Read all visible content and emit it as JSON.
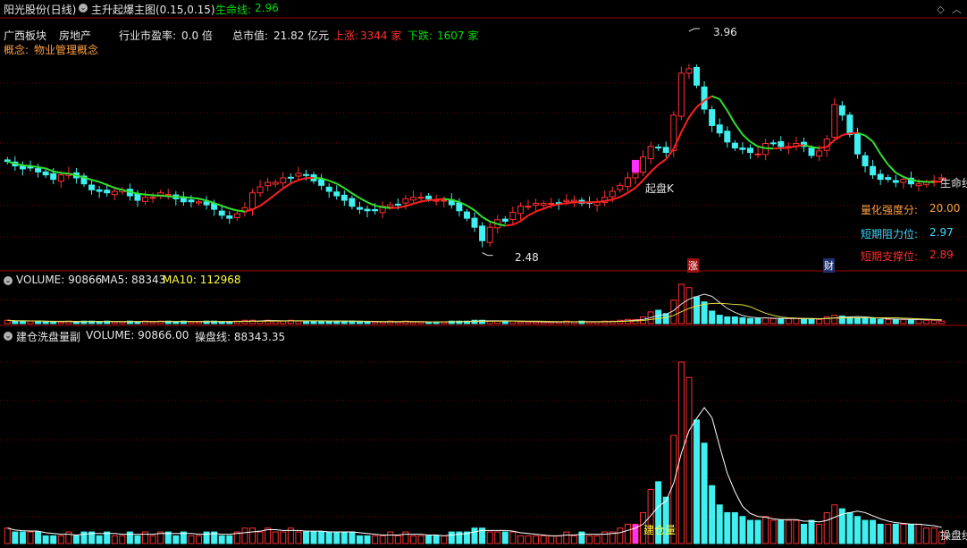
{
  "header": {
    "stock_name": "阳光股份(日线)",
    "indicator_name": "主升起爆主图(0.15,0.15)",
    "life_line_label": "生命线:",
    "life_line_value": "2.96"
  },
  "info": {
    "sector": "广西板块",
    "industry": "房地产",
    "pe_label": "行业市盈率:",
    "pe_value": "0.0 倍",
    "mcap_label": "总市值:",
    "mcap_value": "21.82 亿元",
    "up_label": "上涨:",
    "up_value": "3344 家",
    "down_label": "下跌:",
    "down_value": "1607 家",
    "concept_label": "概念:",
    "concept_value": "物业管理概念"
  },
  "main_panel": {
    "high_label": "3.96",
    "low_label": "2.48",
    "qipan_label": "起盘K",
    "life_line_tag": "生命线",
    "score_label": "量化强度分:",
    "score_value": "20.00",
    "resistance_label": "短期阻力位:",
    "resistance_value": "2.97",
    "support_label": "短期支撑位:",
    "support_value": "2.89",
    "zhang_tag": "涨",
    "cai_tag": "财"
  },
  "volume_panel": {
    "label": "VOLUME: 90866",
    "ma5_label": "MA5: 88343",
    "ma10_label": "MA10: 112968"
  },
  "sub_panel": {
    "title": "建仓洗盘量副",
    "volume_label": "VOLUME: 90866.00",
    "line_label": "操盘线: 88343.35",
    "jiancang_label": "建仓量",
    "caopan_tag": "操盘线"
  },
  "colors": {
    "up": "#ff3030",
    "down": "#40f0f0",
    "life_line_up": "#ff2020",
    "life_line_down": "#30e030",
    "grid": "#7a0000",
    "magenta": "#ff30ff"
  },
  "chart_data": {
    "type": "candlestick",
    "price_range": [
      2.4,
      4.02
    ],
    "high": 3.96,
    "low": 2.48,
    "closes": [
      3.09,
      3.06,
      3.04,
      3.05,
      3.02,
      3.0,
      2.97,
      3.0,
      3.01,
      2.98,
      2.94,
      2.9,
      2.89,
      2.88,
      2.89,
      2.9,
      2.86,
      2.83,
      2.85,
      2.85,
      2.88,
      2.87,
      2.84,
      2.82,
      2.82,
      2.82,
      2.8,
      2.77,
      2.73,
      2.71,
      2.74,
      2.78,
      2.88,
      2.92,
      2.95,
      2.95,
      2.98,
      2.98,
      3.01,
      3.0,
      2.96,
      2.93,
      2.89,
      2.86,
      2.83,
      2.79,
      2.77,
      2.76,
      2.76,
      2.79,
      2.8,
      2.8,
      2.84,
      2.85,
      2.85,
      2.84,
      2.83,
      2.83,
      2.8,
      2.76,
      2.71,
      2.65,
      2.56,
      2.65,
      2.7,
      2.69,
      2.75,
      2.79,
      2.79,
      2.81,
      2.81,
      2.81,
      2.81,
      2.83,
      2.83,
      2.81,
      2.81,
      2.82,
      2.85,
      2.89,
      2.93,
      2.98,
      3.01,
      3.12,
      3.19,
      3.18,
      3.15,
      3.4,
      3.68,
      3.71,
      3.6,
      3.44,
      3.33,
      3.28,
      3.22,
      3.18,
      3.17,
      3.15,
      3.14,
      3.21,
      3.21,
      3.19,
      3.19,
      3.21,
      3.19,
      3.13,
      3.16,
      3.24,
      3.47,
      3.4,
      3.27,
      3.14,
      3.06,
      3.0,
      2.97,
      2.97,
      2.95,
      2.97,
      2.94,
      2.94,
      2.95,
      2.96,
      2.98
    ],
    "volumes": [
      4,
      3,
      3,
      3,
      3,
      2,
      2,
      2,
      3,
      2,
      3,
      3,
      2,
      3,
      2,
      2,
      3,
      2,
      3,
      2,
      3,
      3,
      2,
      3,
      2,
      2,
      3,
      3,
      2,
      2,
      3,
      4,
      4,
      3,
      4,
      3,
      3,
      4,
      3,
      3,
      3,
      3,
      3,
      3,
      3,
      3,
      2,
      2,
      2,
      2,
      3,
      2,
      3,
      2,
      2,
      2,
      2,
      2,
      3,
      3,
      3,
      4,
      4,
      3,
      3,
      3,
      3,
      2,
      2,
      2,
      2,
      2,
      2,
      3,
      2,
      3,
      2,
      2,
      3,
      3,
      4,
      5,
      5,
      8,
      14,
      16,
      12,
      28,
      47,
      43,
      32,
      26,
      15,
      10,
      8,
      8,
      7,
      6,
      6,
      7,
      6,
      6,
      6,
      6,
      5,
      6,
      5,
      8,
      10,
      9,
      8,
      7,
      6,
      6,
      5,
      5,
      5,
      5,
      5,
      5,
      4,
      4,
      3
    ]
  }
}
